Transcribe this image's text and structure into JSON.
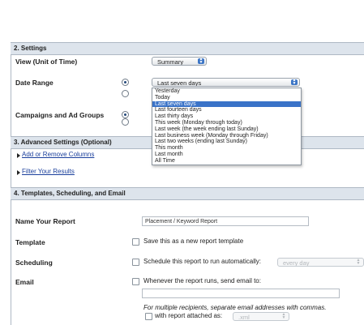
{
  "settings": {
    "header": "2. Settings",
    "view_label": "View (Unit of Time)",
    "view_value": "Summary",
    "date_range_label": "Date Range",
    "date_range_value": "Last seven days",
    "campaigns_label": "Campaigns and Ad Groups"
  },
  "date_options": [
    "Yesterday",
    "Today",
    "Last seven days",
    "Last fourteen days",
    "Last thirty days",
    "This week (Monday through today)",
    "Last week (the week ending last Sunday)",
    "Last business week (Monday through Friday)",
    "Last two weeks (ending last Sunday)",
    "This month",
    "Last month",
    "All Time"
  ],
  "selected_option": "Last seven days",
  "advanced": {
    "header": "3. Advanced Settings (Optional)",
    "columns_link": "Add or Remove Columns",
    "filter_link": "Filter Your Results"
  },
  "templates": {
    "header": "4. Templates, Scheduling, and Email",
    "name_label": "Name Your Report",
    "name_value": "Placement / Keyword Report",
    "template_label": "Template",
    "template_check": "Save this as a new report template",
    "scheduling_label": "Scheduling",
    "scheduling_check": "Schedule this report to run automatically:",
    "scheduling_select": "every day",
    "email_label": "Email",
    "email_check": "Whenever the report runs, send email to:",
    "email_value": "",
    "email_hint": "For multiple recipients, separate email addresses with commas.",
    "attach_check": "with report attached as:",
    "attach_select": ".xml"
  },
  "colors": {
    "section_bg": "#dde4ec",
    "link": "#1a3f9c",
    "selected_option": "#3a73c8"
  }
}
